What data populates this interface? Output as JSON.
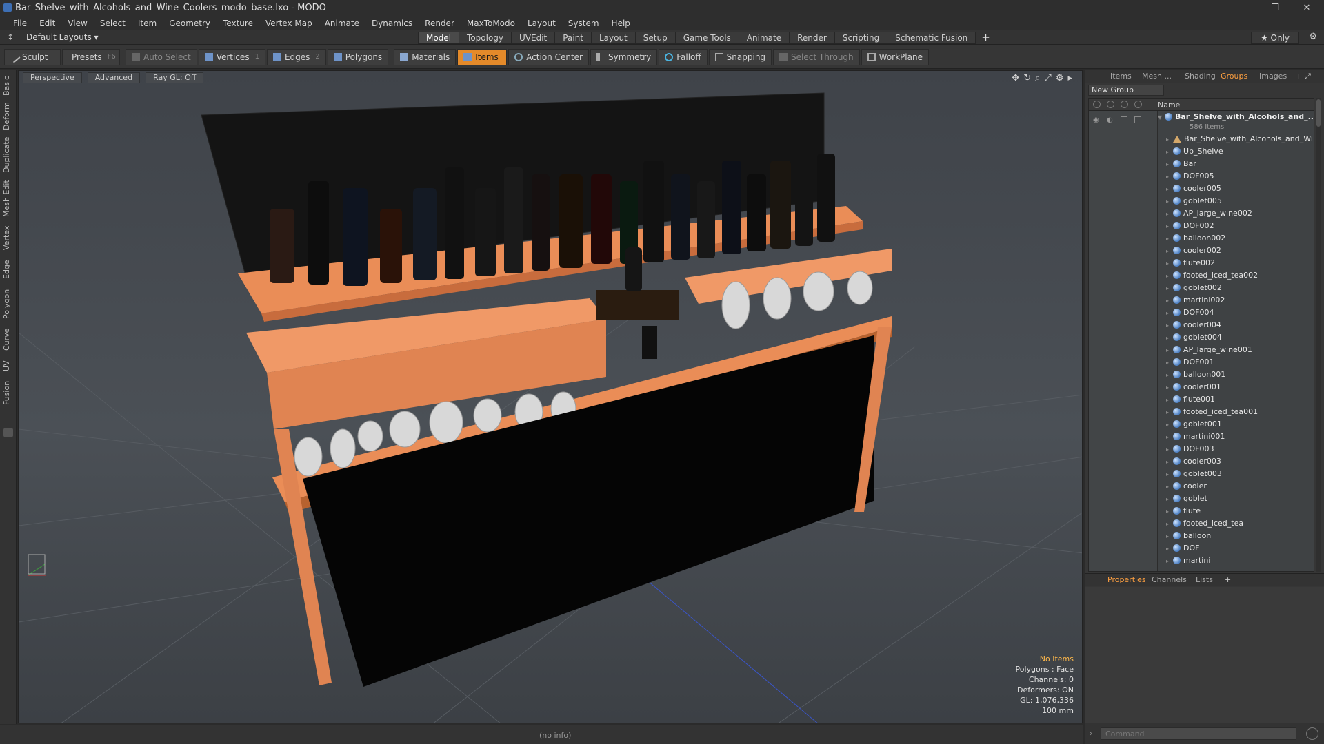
{
  "window": {
    "title": "Bar_Shelve_with_Alcohols_and_Wine_Coolers_modo_base.lxo - MODO",
    "controls": [
      "—",
      "❐",
      "✕"
    ]
  },
  "menu": [
    "File",
    "Edit",
    "View",
    "Select",
    "Item",
    "Geometry",
    "Texture",
    "Vertex Map",
    "Animate",
    "Dynamics",
    "Render",
    "MaxToModo",
    "Layout",
    "System",
    "Help"
  ],
  "layout": {
    "selector": "Default Layouts ▾",
    "tabs": [
      "Model",
      "Topology",
      "UVEdit",
      "Paint",
      "Layout",
      "Setup",
      "Game Tools",
      "Animate",
      "Render",
      "Scripting",
      "Schematic Fusion"
    ],
    "active_tab": "Model",
    "add": "+",
    "only": "★ Only"
  },
  "toolbar": {
    "sculpt": "Sculpt",
    "presets": "Presets",
    "presets_key": "F6",
    "auto_select": "Auto Select",
    "vertices": "Vertices",
    "vertices_key": "1",
    "edges": "Edges",
    "edges_key": "2",
    "polygons": "Polygons",
    "materials": "Materials",
    "items": "Items",
    "action_center": "Action Center",
    "symmetry": "Symmetry",
    "falloff": "Falloff",
    "snapping": "Snapping",
    "select_through": "Select Through",
    "workplane": "WorkPlane"
  },
  "left_tabs": [
    "Basic",
    "Deform",
    "Duplicate",
    "Mesh Edit",
    "Vertex",
    "Edge",
    "Polygon",
    "Curve",
    "UV",
    "Fusion"
  ],
  "viewport": {
    "view": "Perspective",
    "shading": "Advanced",
    "raygl": "Ray GL: Off",
    "info": {
      "items": "No Items",
      "polygons": "Polygons : Face",
      "channels": "Channels: 0",
      "deformers": "Deformers: ON",
      "gl": "GL: 1,076,336",
      "scale": "100 mm"
    }
  },
  "status": {
    "info": "(no info)"
  },
  "right_panel": {
    "tabs": [
      "Items",
      "Mesh ...",
      "Shading",
      "Groups",
      "Images"
    ],
    "active_tab": "Groups",
    "new_group": "New Group",
    "name_col": "Name",
    "root": "Bar_Shelve_with_Alcohols_and_...",
    "root_count": "586 Items",
    "items": [
      "Bar_Shelve_with_Alcohols_and_Wi ...",
      "Up_Shelve",
      "Bar",
      "DOF005",
      "cooler005",
      "goblet005",
      "AP_large_wine002",
      "DOF002",
      "balloon002",
      "cooler002",
      "flute002",
      "footed_iced_tea002",
      "goblet002",
      "martini002",
      "DOF004",
      "cooler004",
      "goblet004",
      "AP_large_wine001",
      "DOF001",
      "balloon001",
      "cooler001",
      "flute001",
      "footed_iced_tea001",
      "goblet001",
      "martini001",
      "DOF003",
      "cooler003",
      "goblet003",
      "cooler",
      "goblet",
      "flute",
      "footed_iced_tea",
      "balloon",
      "DOF",
      "martini"
    ],
    "prop_tabs": [
      "Properties",
      "Channels",
      "Lists"
    ],
    "prop_active": "Properties",
    "command_placeholder": "Command"
  },
  "colors": {
    "accent": "#e48a2a",
    "shelf": "#e98d58",
    "viewport_bg": "#464a4f"
  }
}
